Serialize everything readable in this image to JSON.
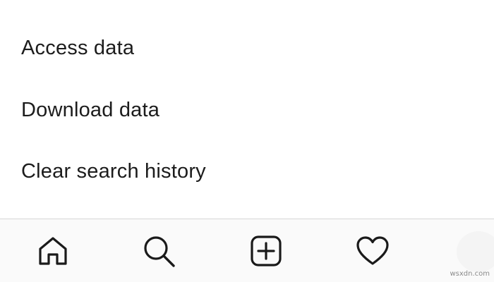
{
  "menu": {
    "items": [
      {
        "label": "Access data"
      },
      {
        "label": "Download data"
      },
      {
        "label": "Clear search history"
      }
    ]
  },
  "bottom_nav": {
    "items": [
      {
        "icon": "home-icon"
      },
      {
        "icon": "search-icon"
      },
      {
        "icon": "new-post-icon"
      },
      {
        "icon": "heart-icon"
      },
      {
        "icon": "profile-avatar"
      }
    ]
  },
  "colors": {
    "text": "#1c1c1c",
    "nav_background": "#fafafa",
    "divider": "#d6d6d6",
    "icon": "#1a1a1a"
  },
  "watermark": "wsxdn.com"
}
